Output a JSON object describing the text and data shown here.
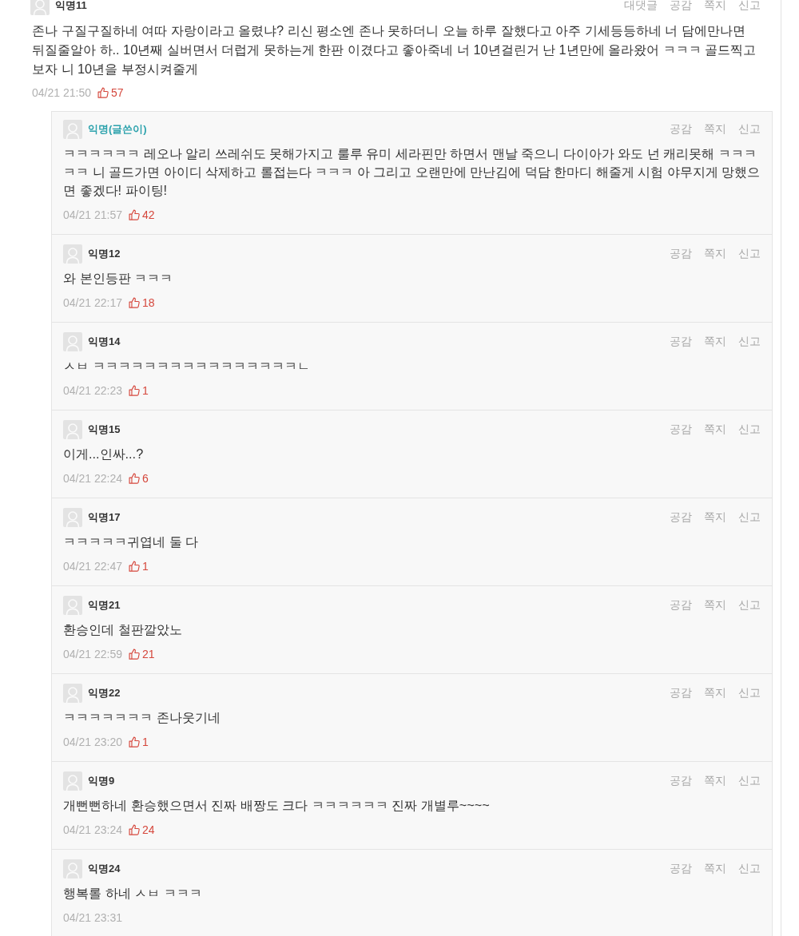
{
  "comment": {
    "author": "익명11",
    "actions": [
      "대댓글",
      "공감",
      "쪽지",
      "신고"
    ],
    "text": "존나 구질구질하네 여따 자랑이라고 올렸냐? 리신 평소엔 존나 못하더니 오늘 하루 잘했다고 아주 기세등등하네 너 담에만나면 뒤질줄알아 하.. 10년째 실버면서 더럽게 못하는게 한판 이겼다고 좋아죽네 너 10년걸린거 난 1년만에 올라왔어 ㅋㅋㅋ 골드찍고 보자 니 10년을 부정시켜줄게",
    "date": "04/21 21:50",
    "likes": "57"
  },
  "replies": [
    {
      "author": "익명(글쓴이)",
      "writer": true,
      "actions": [
        "공감",
        "쪽지",
        "신고"
      ],
      "text": "ㅋㅋㅋㅋㅋㅋ 레오나 알리 쓰레쉬도 못해가지고 룰루 유미 세라핀만 하면서 맨날 죽으니 다이아가 와도 넌 캐리못해 ㅋㅋㅋㅋㅋ 니 골드가면 아이디 삭제하고 롤접는다 ㅋㅋㅋ 아 그리고 오랜만에 만난김에 덕담 한마디 해줄게 시험 야무지게 망했으면 좋겠다! 파이팅!",
      "date": "04/21 21:57",
      "likes": "42"
    },
    {
      "author": "익명12",
      "writer": false,
      "actions": [
        "공감",
        "쪽지",
        "신고"
      ],
      "text": "와 본인등판 ㅋㅋㅋ",
      "date": "04/21 22:17",
      "likes": "18"
    },
    {
      "author": "익명14",
      "writer": false,
      "actions": [
        "공감",
        "쪽지",
        "신고"
      ],
      "text": "ㅅㅂ ㅋㅋㅋㅋㅋㅋㅋㅋㅋㅋㅋㅋㅋㅋㅋㅋㄴ",
      "date": "04/21 22:23",
      "likes": "1"
    },
    {
      "author": "익명15",
      "writer": false,
      "actions": [
        "공감",
        "쪽지",
        "신고"
      ],
      "text": "이게...인싸...?",
      "date": "04/21 22:24",
      "likes": "6"
    },
    {
      "author": "익명17",
      "writer": false,
      "actions": [
        "공감",
        "쪽지",
        "신고"
      ],
      "text": "ㅋㅋㅋㅋㅋ귀엽네 둘 다",
      "date": "04/21 22:47",
      "likes": "1"
    },
    {
      "author": "익명21",
      "writer": false,
      "actions": [
        "공감",
        "쪽지",
        "신고"
      ],
      "text": "환승인데 철판깔았노",
      "date": "04/21 22:59",
      "likes": "21"
    },
    {
      "author": "익명22",
      "writer": false,
      "actions": [
        "공감",
        "쪽지",
        "신고"
      ],
      "text": "ㅋㅋㅋㅋㅋㅋㅋ 존나웃기네",
      "date": "04/21 23:20",
      "likes": "1"
    },
    {
      "author": "익명9",
      "writer": false,
      "actions": [
        "공감",
        "쪽지",
        "신고"
      ],
      "text": "개뻔뻔하네 환승했으면서 진짜 배짱도 크다 ㅋㅋㅋㅋㅋㅋ 진짜 개별루~~~~",
      "date": "04/21 23:24",
      "likes": "24"
    },
    {
      "author": "익명24",
      "writer": false,
      "actions": [
        "공감",
        "쪽지",
        "신고"
      ],
      "text": "행복롤 하네 ㅅㅂ ㅋㅋㅋ",
      "date": "04/21 23:31"
    }
  ]
}
